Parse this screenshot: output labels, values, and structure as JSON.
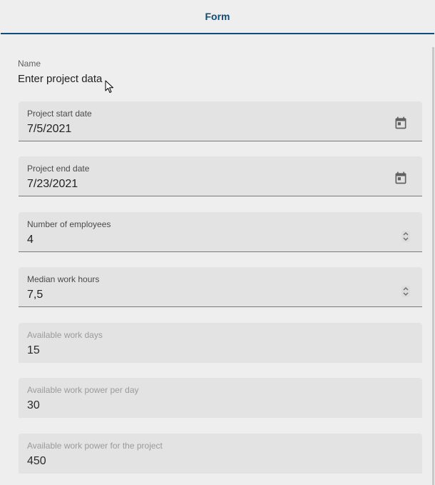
{
  "tabs": [
    {
      "label": "Form"
    }
  ],
  "name": {
    "label": "Name",
    "value": "Enter project data"
  },
  "fields": [
    {
      "label": "Project start date",
      "value": "7/5/2021",
      "icon": "calendar-icon"
    },
    {
      "label": "Project end date",
      "value": "7/23/2021",
      "icon": "calendar-icon"
    },
    {
      "label": "Number of employees",
      "value": "4",
      "icon": "spinner-icon"
    },
    {
      "label": "Median work hours",
      "value": "7,5",
      "icon": "spinner-icon"
    },
    {
      "label": "Available work days",
      "value": "15"
    },
    {
      "label": "Available work power per day",
      "value": "30"
    },
    {
      "label": "Available work power for the project",
      "value": "450"
    }
  ],
  "colors": {
    "accent": "#0d4d7a",
    "field_bg": "#e3e3e3",
    "page_bg": "#eeeeee"
  }
}
